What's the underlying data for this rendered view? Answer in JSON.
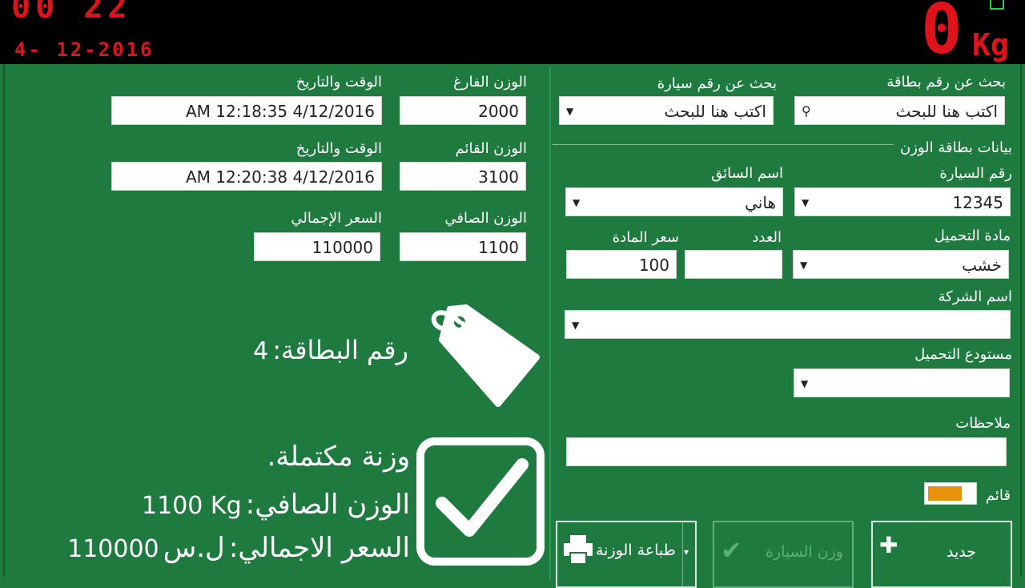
{
  "scale": {
    "time_partial": "00 22",
    "date": "4- 12-2016",
    "weight": "0",
    "unit": "Kg"
  },
  "left": {
    "empty_weight_label": "الوزن الفارغ",
    "empty_weight": "2000",
    "datetime1_label": "الوقت والتاريخ",
    "datetime1": "AM 12:18:35 4/12/2016",
    "loaded_weight_label": "الوزن القائم",
    "loaded_weight": "3100",
    "datetime2_label": "الوقت والتاريخ",
    "datetime2": "AM 12:20:38 4/12/2016",
    "net_weight_label": "الوزن الصافي",
    "net_weight": "1100",
    "total_price_label": "السعر الإجمالي",
    "total_price": "110000",
    "card_number_label": "رقم البطاقة:",
    "card_number": "4",
    "complete_text": "وزنة مكتملة.",
    "net_summary_label": "الوزن الصافي:",
    "net_summary_value": "1100 Kg",
    "total_summary_label": "السعر الاجمالي:",
    "total_summary_currency": "ل.س",
    "total_summary_value": "110000"
  },
  "right": {
    "search_card_label": "بحث عن رقم بطاقة",
    "search_card_placeholder": "اكتب هنا للبحث",
    "search_car_label": "بحث عن رقم سيارة",
    "search_car_placeholder": "اكتب هنا للبحث",
    "section_title": "بيانات بطاقة الوزن",
    "car_number_label": "رقم السيارة",
    "car_number": "12345",
    "driver_label": "اسم السائق",
    "driver": "هاني",
    "material_label": "مادة التحميل",
    "material": "خشب",
    "count_label": "العدد",
    "count": "",
    "price_label": "سعر المادة",
    "price": "100",
    "company_label": "اسم الشركة",
    "company": "",
    "warehouse_label": "مستودع التحميل",
    "warehouse": "",
    "notes_label": "ملاحظات",
    "notes": "",
    "toggle_label": "قائم",
    "new_button": "جديد",
    "weigh_car_button": "وزن السيارة",
    "print_button": "طباعة الوزنة"
  },
  "colors": {
    "background": "#1e7a3e",
    "led_red": "#e0121c",
    "toggle_orange": "#e8920c"
  }
}
